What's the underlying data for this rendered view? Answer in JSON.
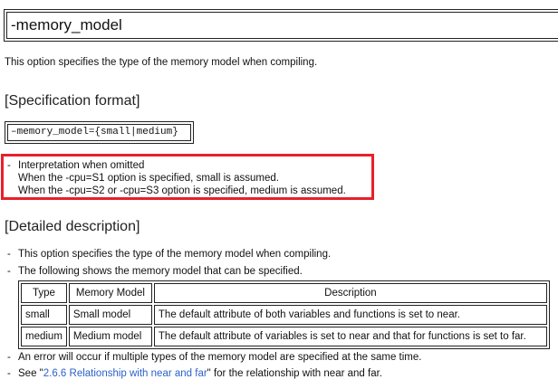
{
  "title": "-memory_model",
  "intro": "This option specifies the type of the memory model when compiling.",
  "spec_heading": "[Specification format]",
  "spec_code": "–memory_model={small|medium}",
  "interpretation": {
    "dash": "-",
    "heading": "Interpretation when omitted",
    "lines": [
      "When the -cpu=S1 option is specified, small is assumed.",
      "When the -cpu=S2 or -cpu=S3 option is specified, medium is assumed."
    ]
  },
  "detail_heading": "[Detailed description]",
  "bullets": {
    "dash": "-",
    "b1": "This option specifies the type of the memory model when compiling.",
    "b2": "The following shows the memory model that can be specified.",
    "b3": "An error will occur if multiple types of the memory model are specified at the same time.",
    "b4_prefix": "See \"",
    "b4_link": "2.6.6 Relationship with near and far",
    "b4_suffix": "\" for the relationship with near and far."
  },
  "table": {
    "headers": [
      "Type",
      "Memory Model",
      "Description"
    ],
    "rows": [
      [
        "small",
        "Small model",
        "The default attribute of both variables and functions is set to near."
      ],
      [
        "medium",
        "Medium model",
        "The default attribute of variables is set to near and that for functions is set to far."
      ]
    ]
  },
  "colors": {
    "highlight": "#e8202a",
    "link": "#2a62c9"
  }
}
